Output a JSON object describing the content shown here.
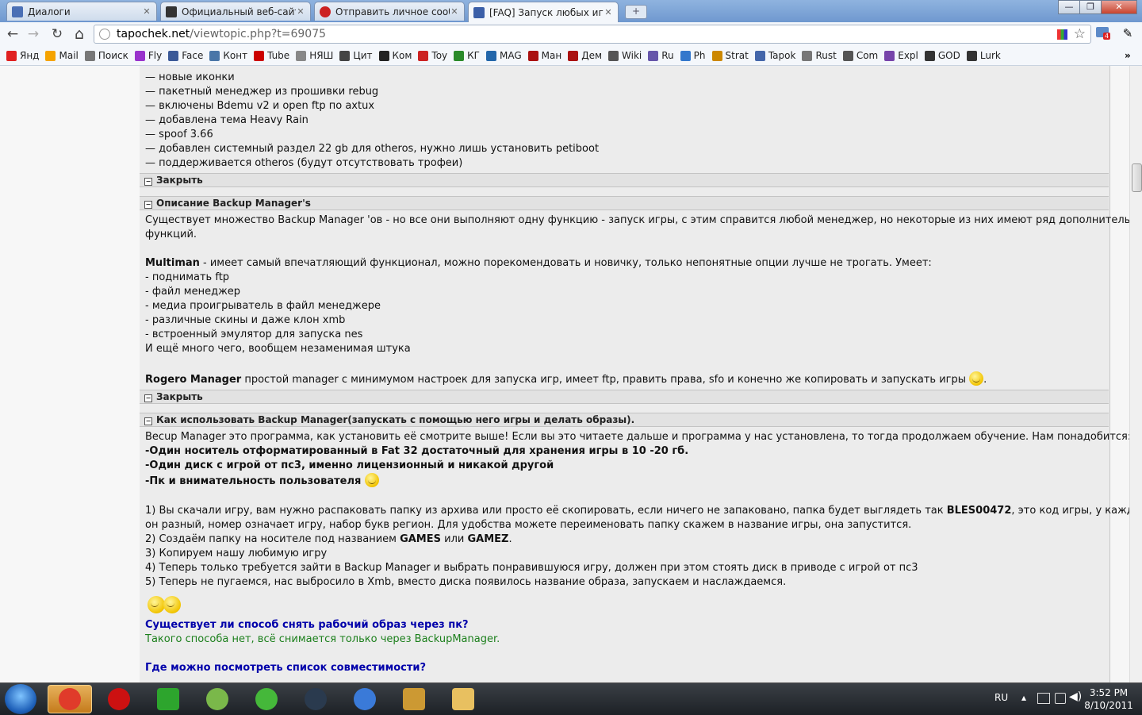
{
  "browser": {
    "tabs": [
      {
        "title": "Диалоги",
        "favicon_color": "#4a6fb5"
      },
      {
        "title": "Официальный веб-сайт Pl",
        "favicon_color": "#333333"
      },
      {
        "title": "Отправить личное сообщ",
        "favicon_color": "#cc2222"
      },
      {
        "title": "[FAQ] Запуск любых игр и",
        "favicon_color": "#3b5fa8",
        "active": true
      }
    ],
    "window_buttons": [
      "—",
      "❐",
      "✕"
    ],
    "address": {
      "host": "tapochek.net",
      "path": "/viewtopic.php?t=69075"
    },
    "nav_icons": {
      "back": "←",
      "forward": "→",
      "reload": "↻",
      "home": "⌂",
      "star": "☆",
      "wrench": "🔧"
    },
    "notification_count": "4",
    "bookmarks": [
      {
        "label": "Янд",
        "color": "#e02020"
      },
      {
        "label": "Mail",
        "color": "#f5a300"
      },
      {
        "label": "Поиск",
        "color": "#777777"
      },
      {
        "label": "Fly",
        "color": "#9933cc"
      },
      {
        "label": "Face",
        "color": "#3b5998"
      },
      {
        "label": "Конт",
        "color": "#4a76a8"
      },
      {
        "label": "Tube",
        "color": "#cc0000"
      },
      {
        "label": "НЯШ",
        "color": "#888888"
      },
      {
        "label": "Цит",
        "color": "#444444"
      },
      {
        "label": "Ком",
        "color": "#222222"
      },
      {
        "label": "Toy",
        "color": "#cc2222"
      },
      {
        "label": "КГ",
        "color": "#2a8a2a"
      },
      {
        "label": "MAG",
        "color": "#2266aa"
      },
      {
        "label": "Ман",
        "color": "#aa1111"
      },
      {
        "label": "Дем",
        "color": "#aa1111"
      },
      {
        "label": "Wiki",
        "color": "#555555"
      },
      {
        "label": "Ru",
        "color": "#6655aa"
      },
      {
        "label": "Ph",
        "color": "#3377cc"
      },
      {
        "label": "Strat",
        "color": "#cc8800"
      },
      {
        "label": "Tapok",
        "color": "#4466aa"
      },
      {
        "label": "Rust",
        "color": "#777777"
      },
      {
        "label": "Com",
        "color": "#555555"
      },
      {
        "label": "Expl",
        "color": "#7744aa"
      },
      {
        "label": "GOD",
        "color": "#333333"
      },
      {
        "label": "Lurk",
        "color": "#333333"
      }
    ],
    "bookmarks_more": "»"
  },
  "post": {
    "top_list": [
      "— новые иконки",
      "— пакетный менеджер из прошивки rebug",
      "— включены Bdemu v2 и open ftp по axtux",
      "— добавлена тема Heavy Rain",
      "— spoof 3.66",
      "— добавлен системный раздел 22 gb для otheros, нужно лишь установить petiboot",
      "— поддерживается otheros (будут отсутствовать трофеи)"
    ],
    "close_label": "Закрыть",
    "toggle_minus": "−",
    "spoiler2": {
      "title": "Описание Backup Manager's",
      "intro": [
        "Существует множество Backup Manager 'ов - но все они выполняют одну функцию - запуск игры, с этим справится любой менеджер, но некоторые из них имеют ряд дополнительных",
        "функций."
      ],
      "multiman_name": "Multiman",
      "multiman_desc": " - имеет самый впечатляющий функционал, можно порекомендовать и новичку, только непонятные опции лучше не трогать. Умеет:",
      "multiman_list": [
        "- поднимать ftp",
        "- файл менеджер",
        "- медиа проигрыватель в файл менеджере",
        "- различные скины и даже клон xmb",
        "- встроенный эмулятор для запуска nes"
      ],
      "multiman_outro": "И ещё много чего, вообщем незаменимая штука",
      "rogero_name": "Rogero Manager",
      "rogero_desc": " простой manager с минимумом настроек для запуска игр, имеет ftp, править права, sfo и конечно же копировать и запускать игры",
      "rogero_end": "."
    },
    "spoiler3": {
      "title": "Как использовать Backup Manager(запускать с помощью него игры и делать образы).",
      "intro": "Becup Manager это программа, как установить её смотрите выше! Если вы это читаете дальше и программа у нас установлена, то тогда продолжаем обучение. Нам понадобится:",
      "req1": "-Один носитель отформатированный в Fat 32 достаточный для хранения игры в 10 -20 гб.",
      "req2": "-Один диск с игрой от пс3, именно лицензионный и никакой другой",
      "req3": "-Пк и внимательность пользователя",
      "step1a_pre": "1) Вы скачали игру, вам нужно распаковать папку из архива или просто её скопировать, если ничего не запаковано, папка будет выглядеть так ",
      "step1a_code": "BLES00472",
      "step1a_post": ", это код игры, у каждой",
      "step1b": "он разный, номер означает игру, набор букв регион. Для удобства можете переименовать папку скажем в название игры, она запустится.",
      "step2_pre": "2) Создаём папку на носителе под названием ",
      "step2_a": "GAMES",
      "step2_or": " или ",
      "step2_b": "GAMEZ",
      "step2_end": ".",
      "step3": "3) Копируем нашу любимую игру",
      "step4": "4) Теперь только требуется зайти в Backup Manager и выбрать понравившуюся игру, должен при этом стоять диск в приводе с игрой от пс3",
      "step5": "5) Теперь не пугаемся, нас выбросило в Xmb, вместо диска появилось название образа, запускаем и наслаждаемся.",
      "q1": "Существует ли способ снять рабочий образ через пк?",
      "a1": "Такого способа нет, всё снимается только через BackupManager.",
      "q2": "Где можно посмотреть список совместимости?"
    }
  },
  "taskbar": {
    "lang": "RU",
    "time": "3:52 PM",
    "date": "8/10/2011",
    "apps": [
      {
        "name": "chrome",
        "color": "#e03b2a",
        "selected": true
      },
      {
        "name": "opera",
        "color": "#cc1111"
      },
      {
        "name": "utorrent",
        "color": "#2da52d"
      },
      {
        "name": "recycle",
        "color": "#7ab84a"
      },
      {
        "name": "icq",
        "color": "#45b83a"
      },
      {
        "name": "steam",
        "color": "#2a3a4e"
      },
      {
        "name": "itunes",
        "color": "#3a7ad8"
      },
      {
        "name": "game",
        "color": "#cc9933"
      },
      {
        "name": "explorer",
        "color": "#e8c060"
      }
    ]
  }
}
